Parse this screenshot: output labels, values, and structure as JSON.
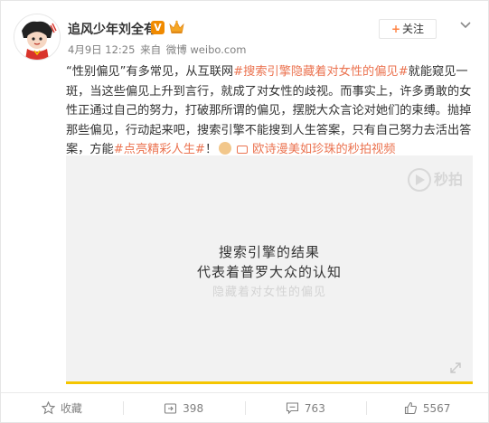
{
  "post": {
    "author": "追风少年刘全有",
    "verified_badge": "V",
    "meta": {
      "date": "4月9日 12:25",
      "source_prefix": "来自",
      "source": "微博 weibo.com"
    },
    "follow_label": "关注",
    "text": {
      "p1": "“性别偏见”有多常见，从互联网",
      "hashtag1": "#搜索引擎隐藏着对女性的偏见#",
      "p2": "就能窥见一斑，当这些偏见上升到言行，就成了对女性的歧视。而事实上，许多勇敢的女性正通过自己的努力，打破那所谓的偏见，摆脱大众言论对她们的束缚。抛掉那些偏见，行动起来吧，搜索引擎不能搜到人生答案，只有自己努力去活出答案，方能",
      "hashtag2": "#点亮精彩人生#",
      "p3": "！",
      "video_link": "欧诗漫美如珍珠的秒拍视频"
    },
    "video": {
      "watermark": "秒拍",
      "caption_line1": "搜索引擎的结果",
      "caption_line2": "代表着普罗大众的认知",
      "caption_line3": "隐藏着对女性的偏见",
      "progress": 1.0
    },
    "actions": {
      "collect": "收藏",
      "repost": "398",
      "comment": "763",
      "like": "5567"
    },
    "colors": {
      "link": "#eb7350",
      "follow_plus": "#ff8140",
      "verified": "#f08a00",
      "progress": "#f5c600"
    }
  }
}
